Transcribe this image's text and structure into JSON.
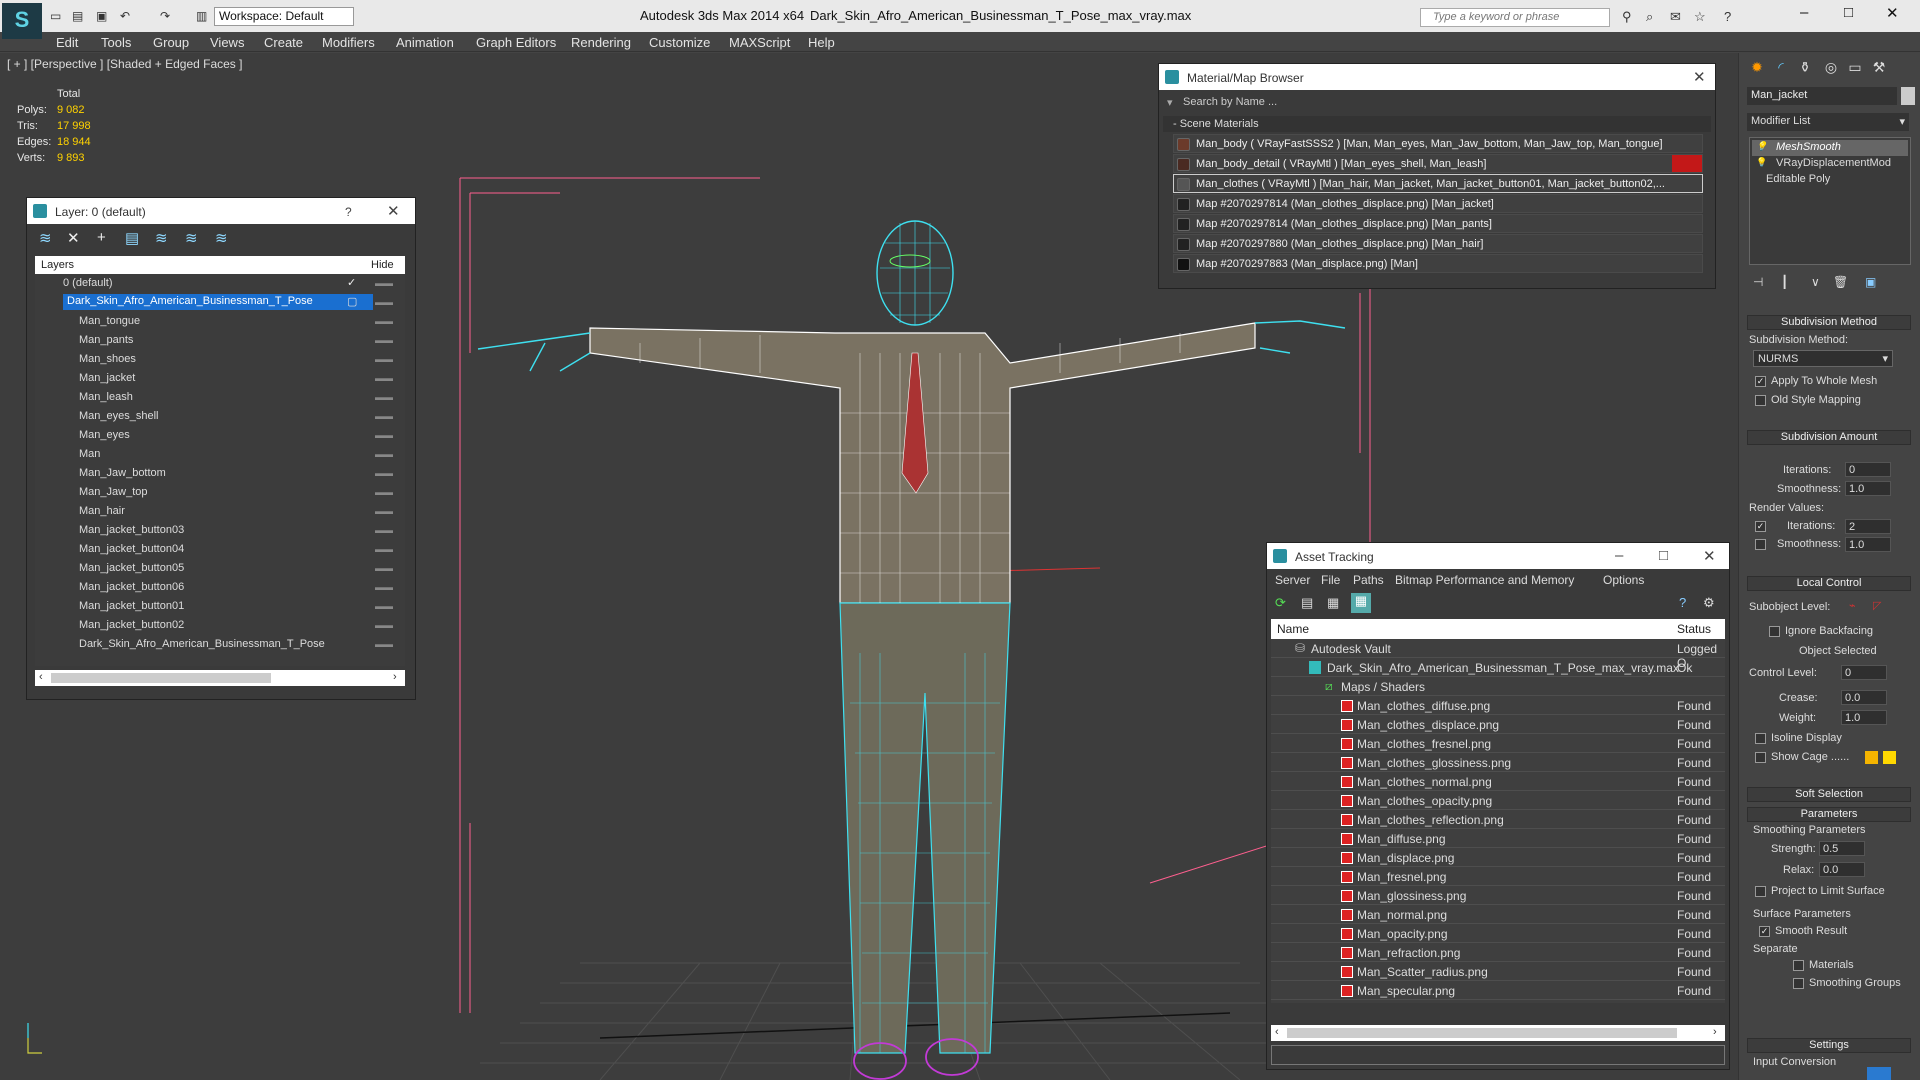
{
  "titlebar": {
    "workspace": "Workspace: Default",
    "app": "Autodesk 3ds Max  2014 x64",
    "doc": "Dark_Skin_Afro_American_Businessman_T_Pose_max_vray.max",
    "search_placeholder": "Type a keyword or phrase"
  },
  "menus": [
    "Edit",
    "Tools",
    "Group",
    "Views",
    "Create",
    "Modifiers",
    "Animation",
    "Graph Editors",
    "Rendering",
    "Customize",
    "MAXScript",
    "Help"
  ],
  "viewport": {
    "label": "[ + ] [Perspective ] [Shaded + Edged Faces ]",
    "stats": {
      "total": "Total",
      "polys_l": "Polys:",
      "polys": "9 082",
      "tris_l": "Tris:",
      "tris": "17 998",
      "edges_l": "Edges:",
      "edges": "18 944",
      "verts_l": "Verts:",
      "verts": "9 893"
    }
  },
  "layer": {
    "title": "Layer: 0 (default)",
    "help": "?",
    "col_layers": "Layers",
    "col_hide": "Hide",
    "rows": [
      "0 (default)",
      "Dark_Skin_Afro_American_Businessman_T_Pose",
      "Man_tongue",
      "Man_pants",
      "Man_shoes",
      "Man_jacket",
      "Man_leash",
      "Man_eyes_shell",
      "Man_eyes",
      "Man",
      "Man_Jaw_bottom",
      "Man_Jaw_top",
      "Man_hair",
      "Man_jacket_button03",
      "Man_jacket_button04",
      "Man_jacket_button05",
      "Man_jacket_button06",
      "Man_jacket_button01",
      "Man_jacket_button02",
      "Dark_Skin_Afro_American_Businessman_T_Pose"
    ]
  },
  "material": {
    "title": "Material/Map Browser",
    "search": "Search by Name ...",
    "section": "- Scene Materials",
    "rows": [
      "Man_body  ( VRayFastSSS2 ) [Man, Man_eyes, Man_Jaw_bottom, Man_Jaw_top, Man_tongue]",
      "Man_body_detail  ( VRayMtl ) [Man_eyes_shell, Man_leash]",
      "Man_clothes  ( VRayMtl ) [Man_hair, Man_jacket, Man_jacket_button01, Man_jacket_button02,...",
      "Map #2070297814 (Man_clothes_displace.png) [Man_jacket]",
      "Map #2070297814 (Man_clothes_displace.png) [Man_pants]",
      "Map #2070297880 (Man_clothes_displace.png) [Man_hair]",
      "Map #2070297883 (Man_displace.png) [Man]"
    ]
  },
  "asset": {
    "title": "Asset Tracking",
    "menus": [
      "Server",
      "File",
      "Paths",
      "Bitmap Performance and Memory",
      "Options"
    ],
    "col_name": "Name",
    "col_status": "Status",
    "rows": [
      {
        "name": "Autodesk Vault",
        "status": "Logged O"
      },
      {
        "name": "Dark_Skin_Afro_American_Businessman_T_Pose_max_vray.max",
        "status": "Ok"
      },
      {
        "name": "Maps / Shaders",
        "status": ""
      },
      {
        "name": "Man_clothes_diffuse.png",
        "status": "Found"
      },
      {
        "name": "Man_clothes_displace.png",
        "status": "Found"
      },
      {
        "name": "Man_clothes_fresnel.png",
        "status": "Found"
      },
      {
        "name": "Man_clothes_glossiness.png",
        "status": "Found"
      },
      {
        "name": "Man_clothes_normal.png",
        "status": "Found"
      },
      {
        "name": "Man_clothes_opacity.png",
        "status": "Found"
      },
      {
        "name": "Man_clothes_reflection.png",
        "status": "Found"
      },
      {
        "name": "Man_diffuse.png",
        "status": "Found"
      },
      {
        "name": "Man_displace.png",
        "status": "Found"
      },
      {
        "name": "Man_fresnel.png",
        "status": "Found"
      },
      {
        "name": "Man_glossiness.png",
        "status": "Found"
      },
      {
        "name": "Man_normal.png",
        "status": "Found"
      },
      {
        "name": "Man_opacity.png",
        "status": "Found"
      },
      {
        "name": "Man_refraction.png",
        "status": "Found"
      },
      {
        "name": "Man_Scatter_radius.png",
        "status": "Found"
      },
      {
        "name": "Man_specular.png",
        "status": "Found"
      }
    ]
  },
  "panel": {
    "objname": "Man_jacket",
    "modlist": "Modifier List",
    "stack": [
      "MeshSmooth",
      "VRayDisplacementMod",
      "Editable Poly"
    ],
    "subdiv_method_h": "Subdivision Method",
    "subdiv_method_l": "Subdivision Method:",
    "subdiv_method": "NURMS",
    "apply_whole": "Apply To Whole Mesh",
    "old_style": "Old Style Mapping",
    "subdiv_amount_h": "Subdivision Amount",
    "iterations_l": "Iterations:",
    "iterations": "0",
    "smoothness_l": "Smoothness:",
    "smoothness": "1.0",
    "render_values": "Render Values:",
    "r_iterations": "2",
    "r_smoothness": "1.0",
    "local_control_h": "Local Control",
    "sublevel": "Subobject Level:",
    "ignore_backfacing": "Ignore Backfacing",
    "object_selected": "Object Selected",
    "control_level_l": "Control Level:",
    "control_level": "0",
    "crease_l": "Crease:",
    "crease": "0.0",
    "weight_l": "Weight:",
    "weight": "1.0",
    "isoline": "Isoline Display",
    "show_cage": "Show Cage ......",
    "soft_sel_h": "Soft Selection",
    "params_h": "Parameters",
    "smoothing_params": "Smoothing Parameters",
    "strength_l": "Strength:",
    "strength": "0.5",
    "relax_l": "Relax:",
    "relax": "0.0",
    "project": "Project to Limit Surface",
    "surface_params": "Surface Parameters",
    "smooth_result": "Smooth Result",
    "separate": "Separate",
    "materials": "Materials",
    "smoothing_groups": "Smoothing Groups",
    "settings_h": "Settings",
    "input_conv": "Input Conversion"
  },
  "colors": {
    "wire_cyan": "#3ee0f0",
    "wire_white": "#ffffff",
    "suit": "#7a7262",
    "pants": "#6d6a5a",
    "shoes": "#c23ad6",
    "guide": "#ff5f8f",
    "stat_yellow": "#ffd200"
  }
}
